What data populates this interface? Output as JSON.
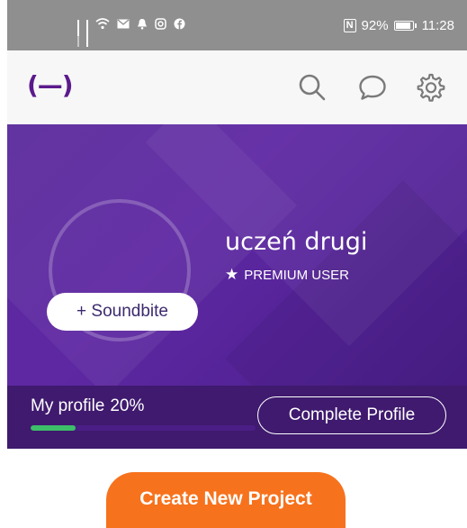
{
  "status_bar": {
    "battery_percent": "92%",
    "time": "11:28",
    "nfc_label": "N",
    "battery_level": 0.92
  },
  "app_bar": {
    "logo_text": "(—)",
    "icons": [
      "search-icon",
      "chat-bubble-icon",
      "gear-icon"
    ]
  },
  "profile": {
    "name": "uczeń drugi",
    "badge": "PREMIUM USER",
    "soundbite_button": "+ Soundbite"
  },
  "progress": {
    "label": "My profile",
    "percent_text": "20%",
    "percent": 0.2,
    "complete_button": "Complete Profile"
  },
  "actions": {
    "create_project": "Create New Project"
  },
  "colors": {
    "accent_purple": "#5a2a9c",
    "progress_green": "#3dbf6a",
    "cta_orange": "#f7721d",
    "logo_purple": "#5b1a8c"
  }
}
